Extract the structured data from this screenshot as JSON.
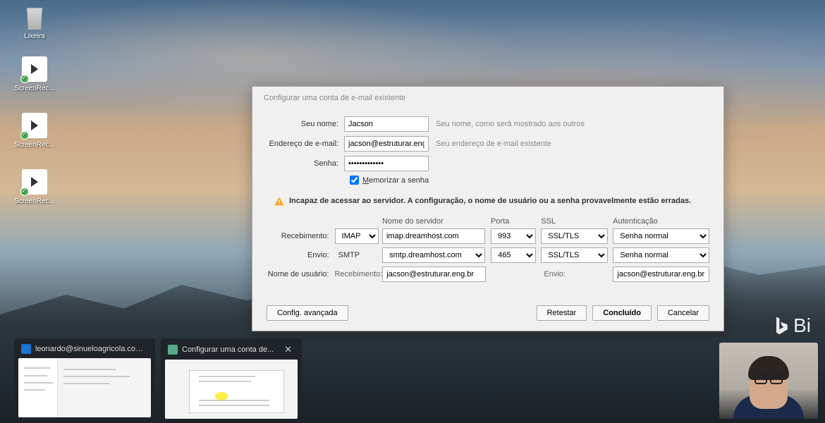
{
  "desktop": {
    "icons": [
      {
        "label": "Lixeira"
      },
      {
        "label": "ScreenRec..."
      },
      {
        "label": "ScreenRec..."
      },
      {
        "label": "ScreenRec..."
      }
    ],
    "watermark": "Bing"
  },
  "dialog": {
    "title": "Configurar uma conta de e-mail existente",
    "name_label": "Seu nome:",
    "name_value": "Jacson",
    "name_hint": "Seu nome, como será mostrado aos outros",
    "email_label": "Endereço de e-mail:",
    "email_value": "jacson@estruturar.eng.br",
    "email_hint": "Seu endereço de e-mail existente",
    "password_label": "Senha:",
    "password_value": "•••••••••••••",
    "remember_label": "Memorizar a senha",
    "warning": "Incapaz de acessar ao servidor. A configuração, o nome de usuário ou a senha provavelmente estão erradas.",
    "headers": {
      "server": "Nome do servidor",
      "port": "Porta",
      "ssl": "SSL",
      "auth": "Autenticação"
    },
    "incoming": {
      "label": "Recebimento:",
      "protocol": "IMAP",
      "server": "imap.dreamhost.com",
      "port": "993",
      "ssl": "SSL/TLS",
      "auth": "Senha normal"
    },
    "outgoing": {
      "label": "Envio:",
      "protocol": "SMTP",
      "server": "smtp.dreamhost.com",
      "port": "465",
      "ssl": "SSL/TLS",
      "auth": "Senha normal"
    },
    "username": {
      "label": "Nome de usuário:",
      "incoming_label": "Recebimento:",
      "incoming_value": "jacson@estruturar.eng.br",
      "outgoing_label": "Envio:",
      "outgoing_value": "jacson@estruturar.eng.br"
    },
    "buttons": {
      "advanced": "Config. avançada",
      "retest": "Retestar",
      "done": "Concluído",
      "cancel": "Cancelar"
    }
  },
  "taskbar": {
    "previews": [
      {
        "title": "leonardo@sinueloagricola.com..."
      },
      {
        "title": "Configurar uma conta de..."
      }
    ]
  }
}
